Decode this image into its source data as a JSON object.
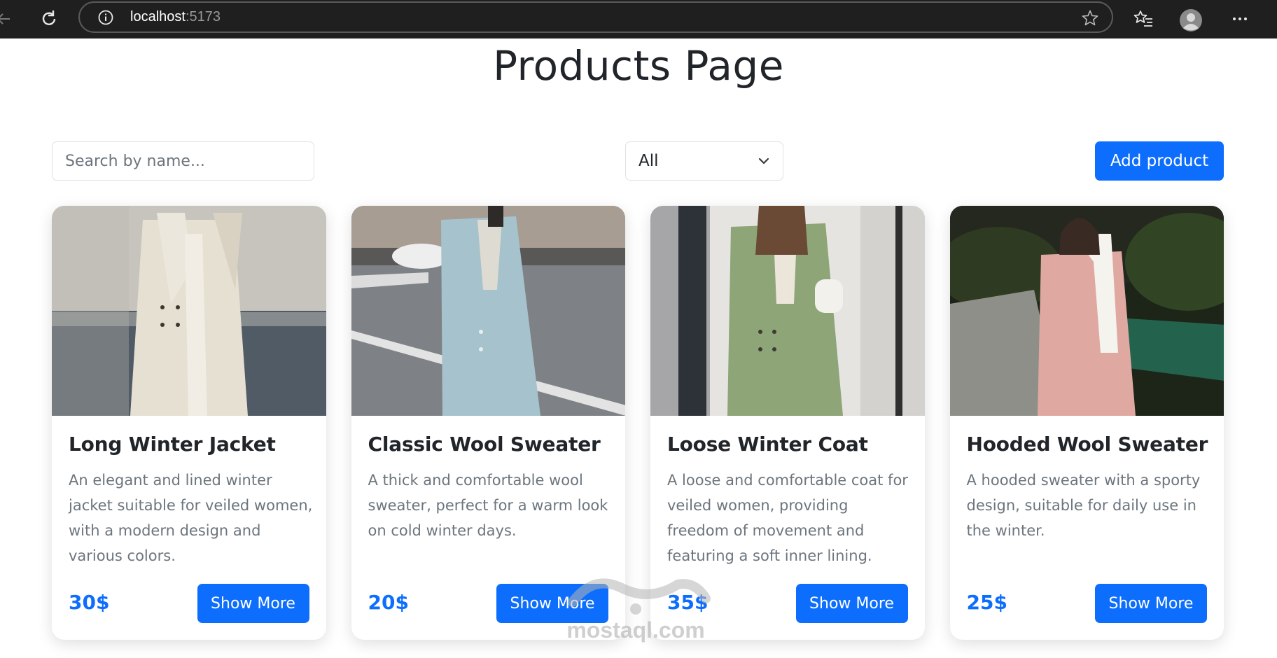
{
  "browser": {
    "url_host": "localhost",
    "url_port": ":5173"
  },
  "page": {
    "title": "Products Page"
  },
  "toolbar": {
    "search_placeholder": "Search by name...",
    "category_selected": "All",
    "add_label": "Add product"
  },
  "products": [
    {
      "title": "Long Winter Jacket",
      "description": "An elegant and lined winter jacket suitable for veiled women, with a modern design and various colors.",
      "price": "30$",
      "button": "Show More"
    },
    {
      "title": "Classic Wool Sweater",
      "description": "A thick and comfortable wool sweater, perfect for a warm look on cold winter days.",
      "price": "20$",
      "button": "Show More"
    },
    {
      "title": "Loose Winter Coat",
      "description": "A loose and comfortable coat for veiled women, providing freedom of movement and featuring a soft inner lining.",
      "price": "35$",
      "button": "Show More"
    },
    {
      "title": "Hooded Wool Sweater",
      "description": "A hooded sweater with a sporty design, suitable for daily use in the winter.",
      "price": "25$",
      "button": "Show More"
    }
  ],
  "watermark": {
    "text": "mostaql.com"
  },
  "colors": {
    "primary": "#0d6efd",
    "chrome_bg": "#1f1f1f"
  }
}
